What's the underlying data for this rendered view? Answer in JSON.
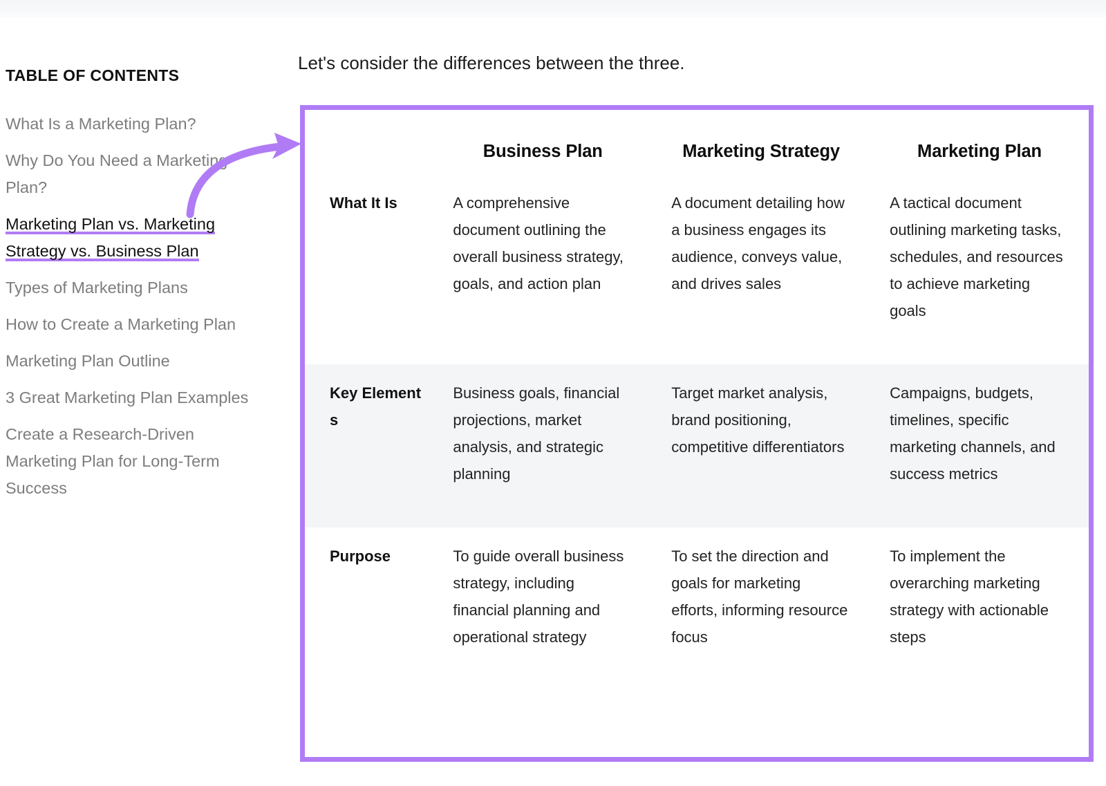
{
  "lead": {
    "text": "Let's consider the differences between the three."
  },
  "toc": {
    "title": "TABLE OF CONTENTS",
    "items": [
      {
        "label": "What Is a Marketing Plan?",
        "active": false
      },
      {
        "label": "Why Do You Need a Marketing Plan?",
        "active": false
      },
      {
        "label": "Marketing Plan vs. Marketing Strategy vs. Business Plan",
        "active": true
      },
      {
        "label": "Types of Marketing Plans",
        "active": false
      },
      {
        "label": "How to Create a Marketing Plan",
        "active": false
      },
      {
        "label": "Marketing Plan Outline",
        "active": false
      },
      {
        "label": "3 Great Marketing Plan Examples",
        "active": false
      },
      {
        "label": "Create a Research-Driven Marketing Plan for Long-Term Success",
        "active": false
      }
    ]
  },
  "comparison_table": {
    "column_headers": [
      "",
      "Business Plan",
      "Marketing Strategy",
      "Marketing Plan"
    ],
    "rows": [
      {
        "label": "What It Is",
        "shaded": false,
        "cells": [
          "A comprehensive document outlining the overall business strategy, goals, and action plan",
          "A document detailing how a business engages its audience, conveys value, and drives sales",
          "A tactical document outlining marketing tasks, schedules, and resources to achieve marketing goals"
        ]
      },
      {
        "label": "Key Elements",
        "shaded": true,
        "cells": [
          "Business goals, financial projections, market analysis, and strategic planning",
          "Target market analysis, brand positioning, competitive differentiators",
          "Campaigns, budgets, timelines, specific marketing channels, and success metrics"
        ]
      },
      {
        "label": "Purpose",
        "shaded": false,
        "cells": [
          "To guide overall business strategy, including financial planning and operational strategy",
          "To set the direction and goals for marketing efforts, informing resource focus",
          "To implement the overarching marketing strategy with actionable steps"
        ]
      }
    ]
  },
  "colors": {
    "accent_purple": "#b07cf5",
    "shaded_row": "#f4f5f7",
    "muted_text": "#7d7d7d",
    "body_text": "#222222"
  },
  "annotation": {
    "arrow": "curved-arrow-icon"
  }
}
